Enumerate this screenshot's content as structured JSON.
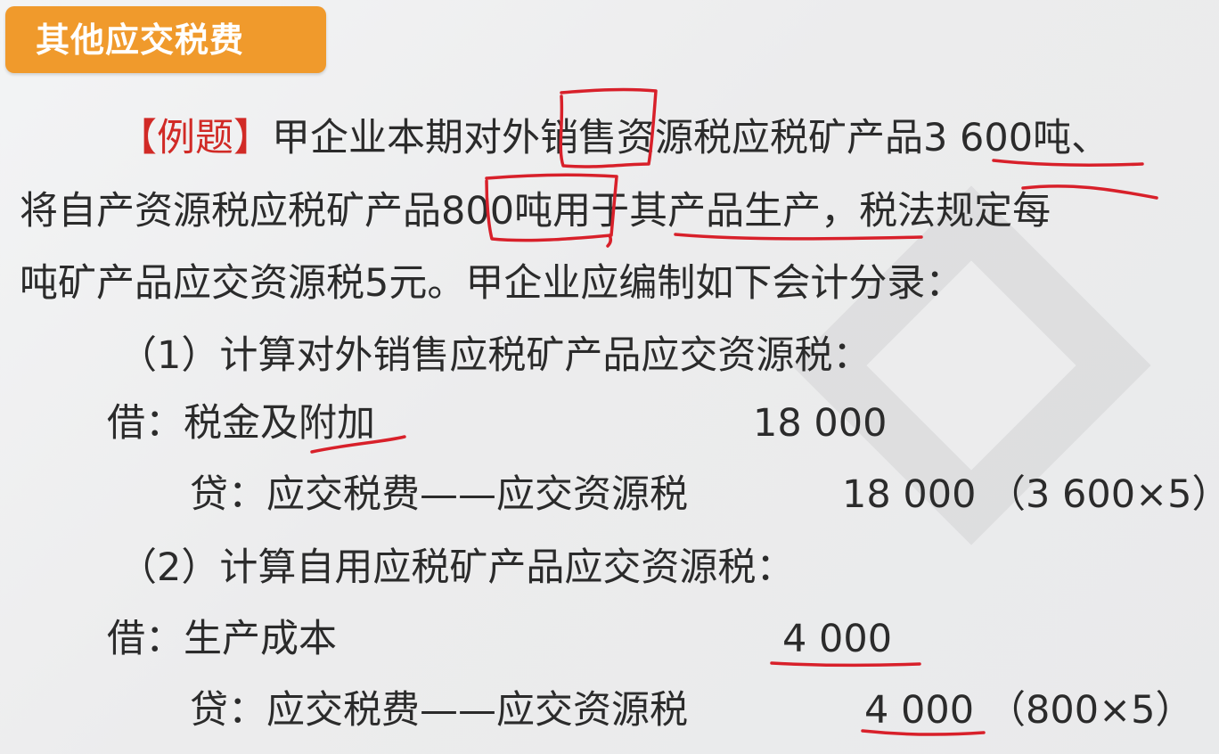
{
  "title": "其他应交税费",
  "example": {
    "tag": "【例题】",
    "line1": "甲企业本期对外销售资源税应税矿产品3 600吨、",
    "line2": "将自产资源税应税矿产品800吨用于其产品生产，税法规定每",
    "line3": "吨矿产品应交资源税5元。甲企业应编制如下会计分录："
  },
  "step1": {
    "heading": "（1）计算对外销售应税矿产品应交资源税：",
    "debit_label": "借：税金及附加",
    "debit_amount": "18 000",
    "credit_label": "贷：应交税费——应交资源税",
    "credit_amount": "18 000",
    "credit_note": "（3 600×5）"
  },
  "step2": {
    "heading": "（2）计算自用应税矿产品应交资源税：",
    "debit_label": "借：生产成本",
    "debit_amount": "4 000",
    "credit_label": "贷：应交税费——应交资源税",
    "credit_amount": "4 000",
    "credit_note": "（800×5）"
  },
  "colors": {
    "badge": "#f09a2c",
    "annotation": "#d8202a",
    "tag": "#d12a26"
  }
}
